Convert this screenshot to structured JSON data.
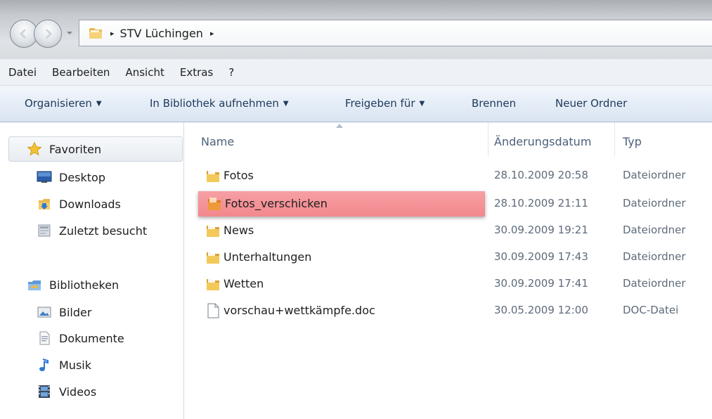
{
  "address_bar": {
    "path": [
      "STV Lüchingen"
    ],
    "separator_glyph": "▸"
  },
  "menu": {
    "items": [
      "Datei",
      "Bearbeiten",
      "Ansicht",
      "Extras",
      "?"
    ]
  },
  "command_bar": {
    "organize": "Organisieren",
    "include_library": "In Bibliothek aufnehmen",
    "share_with": "Freigeben für",
    "burn": "Brennen",
    "new_folder": "Neuer Ordner",
    "dropdown_glyph": "▼"
  },
  "navigation": {
    "favorites": {
      "label": "Favoriten",
      "icon": "star-icon",
      "items": [
        {
          "label": "Desktop",
          "icon": "desktop-icon"
        },
        {
          "label": "Downloads",
          "icon": "downloads-icon"
        },
        {
          "label": "Zuletzt besucht",
          "icon": "recent-places-icon"
        }
      ]
    },
    "libraries": {
      "label": "Bibliotheken",
      "icon": "library-icon",
      "items": [
        {
          "label": "Bilder",
          "icon": "pictures-icon"
        },
        {
          "label": "Dokumente",
          "icon": "documents-icon"
        },
        {
          "label": "Musik",
          "icon": "music-icon"
        },
        {
          "label": "Videos",
          "icon": "videos-icon"
        }
      ]
    }
  },
  "file_list": {
    "columns": {
      "name": "Name",
      "date": "Änderungsdatum",
      "type": "Typ"
    },
    "rows": [
      {
        "name": "Fotos",
        "date": "28.10.2009 20:58",
        "type": "Dateiordner",
        "icon": "folder-icon"
      },
      {
        "name": "Fotos_verschicken",
        "date": "28.10.2009 21:11",
        "type": "Dateiordner",
        "icon": "folder-icon",
        "selected": true
      },
      {
        "name": "News",
        "date": "30.09.2009 19:21",
        "type": "Dateiordner",
        "icon": "folder-icon"
      },
      {
        "name": "Unterhaltungen",
        "date": "30.09.2009 17:43",
        "type": "Dateiordner",
        "icon": "folder-icon"
      },
      {
        "name": "Wetten",
        "date": "30.09.2009 17:41",
        "type": "Dateiordner",
        "icon": "folder-icon"
      },
      {
        "name": "vorschau+wettkämpfe.doc",
        "date": "30.05.2009 12:00",
        "type": "DOC-Datei",
        "icon": "document-icon"
      }
    ]
  },
  "colors": {
    "selection_highlight": "#f2888d",
    "command_text": "#1e395b",
    "column_header_text": "#4c607a",
    "secondary_text": "#5e6b7a"
  }
}
